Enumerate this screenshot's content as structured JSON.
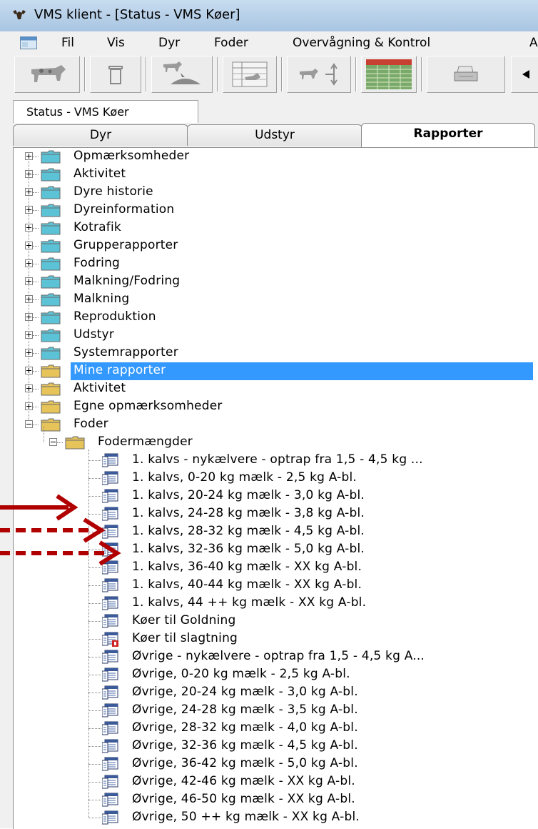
{
  "window": {
    "title": "VMS klient - [Status - VMS Køer]"
  },
  "menu": [
    "Fil",
    "Vis",
    "Dyr",
    "Foder",
    "Overvågning & Kontrol",
    "A"
  ],
  "toolbar": {
    "buttons": [
      "cow-icon",
      "trash-icon",
      "feed-icon",
      "table-icon",
      "animal-move-icon",
      "report-grid-icon",
      "print-icon",
      "back-arrow-icon"
    ]
  },
  "document_tab": "Status - VMS Køer",
  "tabs": [
    {
      "label": "Dyr",
      "active": false
    },
    {
      "label": "Udstyr",
      "active": false
    },
    {
      "label": "Rapporter",
      "active": true
    }
  ],
  "colors": {
    "selection": "#3399ff",
    "folder_blue": "#5cc3d6",
    "folder_yellow": "#e6c45a",
    "arrow": "#b00000"
  },
  "tree": {
    "top_folders": [
      {
        "label": "Opmærksomheder",
        "color": "blue"
      },
      {
        "label": "Aktivitet",
        "color": "blue"
      },
      {
        "label": "Dyre historie",
        "color": "blue"
      },
      {
        "label": "Dyreinformation",
        "color": "blue"
      },
      {
        "label": "Kotrafik",
        "color": "blue"
      },
      {
        "label": "Grupperapporter",
        "color": "blue"
      },
      {
        "label": "Fodring",
        "color": "blue"
      },
      {
        "label": "Malkning/Fodring",
        "color": "blue"
      },
      {
        "label": "Malkning",
        "color": "blue"
      },
      {
        "label": "Reproduktion",
        "color": "blue"
      },
      {
        "label": "Udstyr",
        "color": "blue"
      },
      {
        "label": "Systemrapporter",
        "color": "blue"
      },
      {
        "label": "Mine rapporter",
        "color": "yellow",
        "selected": true
      },
      {
        "label": "Aktivitet",
        "color": "yellow"
      },
      {
        "label": "Egne opmærksomheder",
        "color": "yellow"
      },
      {
        "label": "Foder",
        "color": "yellow",
        "expanded": true
      }
    ],
    "subfolder": {
      "label": "Fodermængder",
      "color": "yellow",
      "expanded": true
    },
    "reports": [
      {
        "label": "1. kalvs - nykælvere - optrap fra 1,5 - 4,5 kg ..."
      },
      {
        "label": "1. kalvs, 0-20 kg mælk - 2,5 kg A-bl."
      },
      {
        "label": "1. kalvs, 20-24 kg mælk - 3,0 kg A-bl."
      },
      {
        "label": "1. kalvs, 24-28 kg mælk - 3,8 kg A-bl."
      },
      {
        "label": "1. kalvs, 28-32 kg mælk - 4,5 kg A-bl."
      },
      {
        "label": "1. kalvs, 32-36 kg mælk  - 5,0 kg A-bl."
      },
      {
        "label": "1. kalvs, 36-40 kg mælk  - XX kg A-bl."
      },
      {
        "label": "1. kalvs, 40-44 kg mælk  - XX kg A-bl."
      },
      {
        "label": "1. kalvs, 44 ++ kg mælk  - XX kg A-bl."
      },
      {
        "label": "Køer til Goldning"
      },
      {
        "label": "Køer til slagtning",
        "flag": "red"
      },
      {
        "label": "Øvrige - nykælvere - optrap fra 1,5 - 4,5 kg A..."
      },
      {
        "label": "Øvrige, 0-20 kg mælk  - 2,5 kg A-bl."
      },
      {
        "label": "Øvrige, 20-24 kg mælk  - 3,0 kg A-bl."
      },
      {
        "label": "Øvrige, 24-28 kg mælk  - 3,5 kg A-bl."
      },
      {
        "label": "Øvrige, 28-32 kg mælk  - 4,0 kg A-bl."
      },
      {
        "label": "Øvrige, 32-36 kg mælk  - 4,5 kg A-bl."
      },
      {
        "label": "Øvrige, 36-42 kg mælk  - 5,0 kg A-bl."
      },
      {
        "label": "Øvrige, 42-46 kg mælk  - XX kg A-bl."
      },
      {
        "label": "Øvrige, 46-50 kg mælk  - XX kg A-bl."
      },
      {
        "label": "Øvrige, 50 ++ kg mælk  - XX kg A-bl."
      }
    ]
  },
  "annotations": [
    {
      "style": "solid",
      "points_to": "1. kalvs, 24-28 kg mælk - 3,8 kg A-bl."
    },
    {
      "style": "dashed",
      "points_to": "1. kalvs, 28-32 kg mælk - 4,5 kg A-bl."
    },
    {
      "style": "dashed",
      "points_to": "1. kalvs, 32-36 kg mælk  - 5,0 kg A-bl."
    }
  ]
}
